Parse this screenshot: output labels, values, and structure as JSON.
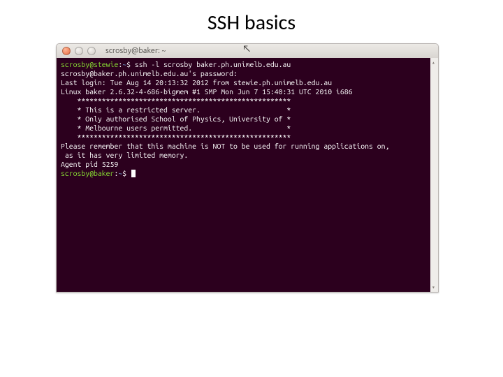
{
  "slide": {
    "title": "SSH basics"
  },
  "window": {
    "title": "scrosby@baker: ~"
  },
  "term": {
    "prompt1_userhost": "scrosby@stewie",
    "prompt1_path": "~",
    "prompt1_cmd": "$ ssh -l scrosby baker.ph.unimelb.edu.au",
    "pwprompt": "scrosby@baker.ph.unimelb.edu.au's password:",
    "lastlogin": "Last login: Tue Aug 14 20:13:32 2012 from stewie.ph.unimelb.edu.au",
    "uname": "Linux baker 2.6.32-4-686-bigmem #1 SMP Mon Jun 7 15:40:31 UTC 2010 i686",
    "blank": "",
    "stars": "    ****************************************************",
    "motd1": "    * This is a restricted server.                     *",
    "motd2": "    * Only authorised School of Physics, University of *",
    "motd3": "    * Melbourne users permitted.                       *",
    "notice1": "Please remember that this machine is NOT to be used for running applications on,",
    "notice2": " as it has very limited memory.",
    "agent": "Agent pid 5259",
    "prompt2_userhost": "scrosby@baker",
    "prompt2_path": "~",
    "prompt2_cmd": "$ "
  }
}
